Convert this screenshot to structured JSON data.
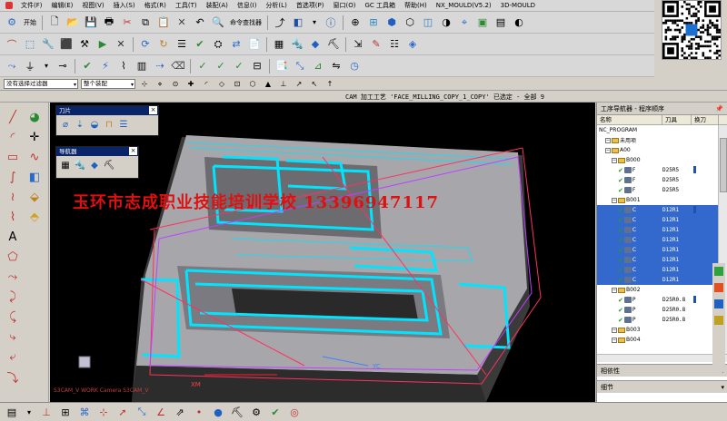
{
  "menubar": {
    "items": [
      "文件(F)",
      "编辑(E)",
      "视图(V)",
      "插入(S)",
      "格式(R)",
      "工具(T)",
      "装配(A)",
      "信息(I)",
      "分析(L)",
      "首选项(P)",
      "窗口(O)",
      "GC 工具箱",
      "帮助(H)",
      "NX_MOULD(V5.2)",
      "3D-MOULD"
    ]
  },
  "toolbar": {
    "start_label": "开始",
    "command_finder_label": "命令查找器"
  },
  "qr": {
    "caption": ""
  },
  "selection": {
    "filter_value": "没有选择过滤器",
    "scope_value": "整个装配"
  },
  "status": {
    "message": "CAM 加工工艺 'FACE_MILLING_COPY_1_COPY' 已选定 - 全部 9"
  },
  "viewport": {
    "watermark": "玉环市志成职业技能培训学校 13396947117",
    "camera_label": "S3CAM_V WORK Camera S3CAM_V",
    "axis_x": "XM",
    "axis_y": "YC",
    "axis_z": "ZM"
  },
  "float_panels": {
    "tools_title": "刀片",
    "navigator_title": "导航器"
  },
  "navigator": {
    "title": "工序导航器 - 程序顺序",
    "columns": [
      "名称",
      "刀具",
      "换刀"
    ],
    "rows": [
      {
        "name": "NC_PROGRAM",
        "tool": "",
        "indent": 0,
        "type": "root",
        "sel": false
      },
      {
        "name": "未用项",
        "tool": "",
        "indent": 1,
        "type": "folder",
        "sel": false
      },
      {
        "name": "A00",
        "tool": "",
        "indent": 1,
        "type": "folder",
        "sel": false
      },
      {
        "name": "B000",
        "tool": "",
        "indent": 2,
        "type": "folder",
        "sel": false
      },
      {
        "name": "F",
        "tool": "D25R5",
        "indent": 3,
        "type": "op",
        "sel": false
      },
      {
        "name": "F",
        "tool": "D25R5",
        "indent": 3,
        "type": "op",
        "sel": false
      },
      {
        "name": "F",
        "tool": "D25R5",
        "indent": 3,
        "type": "op",
        "sel": false
      },
      {
        "name": "B001",
        "tool": "",
        "indent": 2,
        "type": "folder",
        "sel": false
      },
      {
        "name": "C",
        "tool": "D12R1",
        "indent": 3,
        "type": "op",
        "sel": true
      },
      {
        "name": "C",
        "tool": "D12R1",
        "indent": 3,
        "type": "op",
        "sel": true
      },
      {
        "name": "C",
        "tool": "D12R1",
        "indent": 3,
        "type": "op",
        "sel": true
      },
      {
        "name": "C",
        "tool": "D12R1",
        "indent": 3,
        "type": "op",
        "sel": true
      },
      {
        "name": "C",
        "tool": "D12R1",
        "indent": 3,
        "type": "op",
        "sel": true
      },
      {
        "name": "C",
        "tool": "D12R1",
        "indent": 3,
        "type": "op",
        "sel": true
      },
      {
        "name": "C",
        "tool": "D12R1",
        "indent": 3,
        "type": "op",
        "sel": true
      },
      {
        "name": "C",
        "tool": "D12R1",
        "indent": 3,
        "type": "op",
        "sel": true
      },
      {
        "name": "B002",
        "tool": "",
        "indent": 2,
        "type": "folder",
        "sel": false
      },
      {
        "name": "P",
        "tool": "D25R0.8",
        "indent": 3,
        "type": "op",
        "sel": false
      },
      {
        "name": "P",
        "tool": "D25R0.8",
        "indent": 3,
        "type": "op",
        "sel": false
      },
      {
        "name": "P",
        "tool": "D25R0.8",
        "indent": 3,
        "type": "op",
        "sel": false
      },
      {
        "name": "B003",
        "tool": "",
        "indent": 2,
        "type": "folder",
        "sel": false
      },
      {
        "name": "B004",
        "tool": "",
        "indent": 2,
        "type": "folder",
        "sel": false
      }
    ],
    "section_dependencies": "相依性",
    "section_details": "细节"
  },
  "colors": {
    "selection": "#3369cc",
    "check": "#1fa01f",
    "toolpath": "#00e5ff",
    "watermark": "#e01010",
    "titlebar": "#0a246a"
  }
}
